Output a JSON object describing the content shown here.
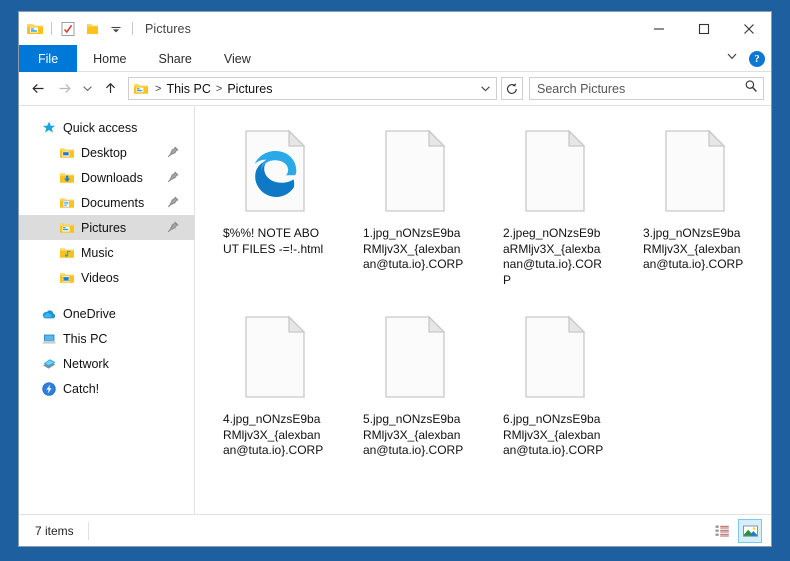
{
  "window": {
    "title": "Pictures",
    "quick_access_toolbar": [
      {
        "name": "properties-icon",
        "tooltip": "Properties"
      },
      {
        "name": "new-folder-icon",
        "tooltip": "New folder"
      },
      {
        "name": "customize-qat-chevron-icon",
        "tooltip": "Customize Quick Access Toolbar"
      }
    ],
    "caption_buttons": {
      "minimize": "Minimize",
      "maximize": "Maximize",
      "close": "Close"
    }
  },
  "ribbon": {
    "tabs": [
      {
        "label": "File",
        "active": true
      },
      {
        "label": "Home",
        "active": false
      },
      {
        "label": "Share",
        "active": false
      },
      {
        "label": "View",
        "active": false
      }
    ],
    "expand_label": "Expand the Ribbon",
    "help_label": "?"
  },
  "address": {
    "back": "Back",
    "forward": "Forward",
    "recent": "Recent locations",
    "up": "Up",
    "breadcrumbs": [
      "This PC",
      "Pictures"
    ],
    "breadcrumb_sep": ">",
    "dropdown": "Previous locations",
    "refresh": "Refresh"
  },
  "search": {
    "placeholder": "Search Pictures",
    "value": ""
  },
  "sidebar": {
    "items": [
      {
        "label": "Quick access",
        "icon": "star-icon",
        "level": 0,
        "selected": false,
        "pinned": false
      },
      {
        "label": "Desktop",
        "icon": "desktop-folder-icon",
        "level": 1,
        "selected": false,
        "pinned": true
      },
      {
        "label": "Downloads",
        "icon": "downloads-folder-icon",
        "level": 1,
        "selected": false,
        "pinned": true
      },
      {
        "label": "Documents",
        "icon": "documents-folder-icon",
        "level": 1,
        "selected": false,
        "pinned": true
      },
      {
        "label": "Pictures",
        "icon": "pictures-folder-icon",
        "level": 1,
        "selected": true,
        "pinned": true
      },
      {
        "label": "Music",
        "icon": "music-folder-icon",
        "level": 1,
        "selected": false,
        "pinned": false
      },
      {
        "label": "Videos",
        "icon": "videos-folder-icon",
        "level": 1,
        "selected": false,
        "pinned": false
      },
      {
        "label": "OneDrive",
        "icon": "onedrive-cloud-icon",
        "level": 0,
        "selected": false,
        "pinned": false
      },
      {
        "label": "This PC",
        "icon": "this-pc-icon",
        "level": 0,
        "selected": false,
        "pinned": false
      },
      {
        "label": "Network",
        "icon": "network-icon",
        "level": 0,
        "selected": false,
        "pinned": false
      },
      {
        "label": "Catch!",
        "icon": "catch-icon",
        "level": 0,
        "selected": false,
        "pinned": false
      }
    ]
  },
  "files": [
    {
      "name": "$%%! NOTE ABOUT FILES -=!-.html",
      "icon": "edge-html-icon"
    },
    {
      "name": "1.jpg_nONzsE9baRMljv3X_{alexbanan@tuta.io}.CORP",
      "icon": "blank-file-icon"
    },
    {
      "name": "2.jpeg_nONzsE9baRMljv3X_{alexbanan@tuta.io}.CORP",
      "icon": "blank-file-icon"
    },
    {
      "name": "3.jpg_nONzsE9baRMljv3X_{alexbanan@tuta.io}.CORP",
      "icon": "blank-file-icon"
    },
    {
      "name": "4.jpg_nONzsE9baRMljv3X_{alexbanan@tuta.io}.CORP",
      "icon": "blank-file-icon"
    },
    {
      "name": "5.jpg_nONzsE9baRMljv3X_{alexbanan@tuta.io}.CORP",
      "icon": "blank-file-icon"
    },
    {
      "name": "6.jpg_nONzsE9baRMljv3X_{alexbanan@tuta.io}.CORP",
      "icon": "blank-file-icon"
    }
  ],
  "statusbar": {
    "item_count": "7 items",
    "views": [
      {
        "name": "details-view-button",
        "label": "Details view",
        "active": false
      },
      {
        "name": "large-icons-view-button",
        "label": "Large icons view",
        "active": true
      }
    ]
  },
  "colors": {
    "desktop": "#1e5fa0",
    "accent": "#0078d7",
    "selection": "#dcdcdc",
    "edge_blue": "#0f79c6",
    "folder_yellow": "#fcc21b",
    "view_active_border": "#7bc9e8"
  }
}
